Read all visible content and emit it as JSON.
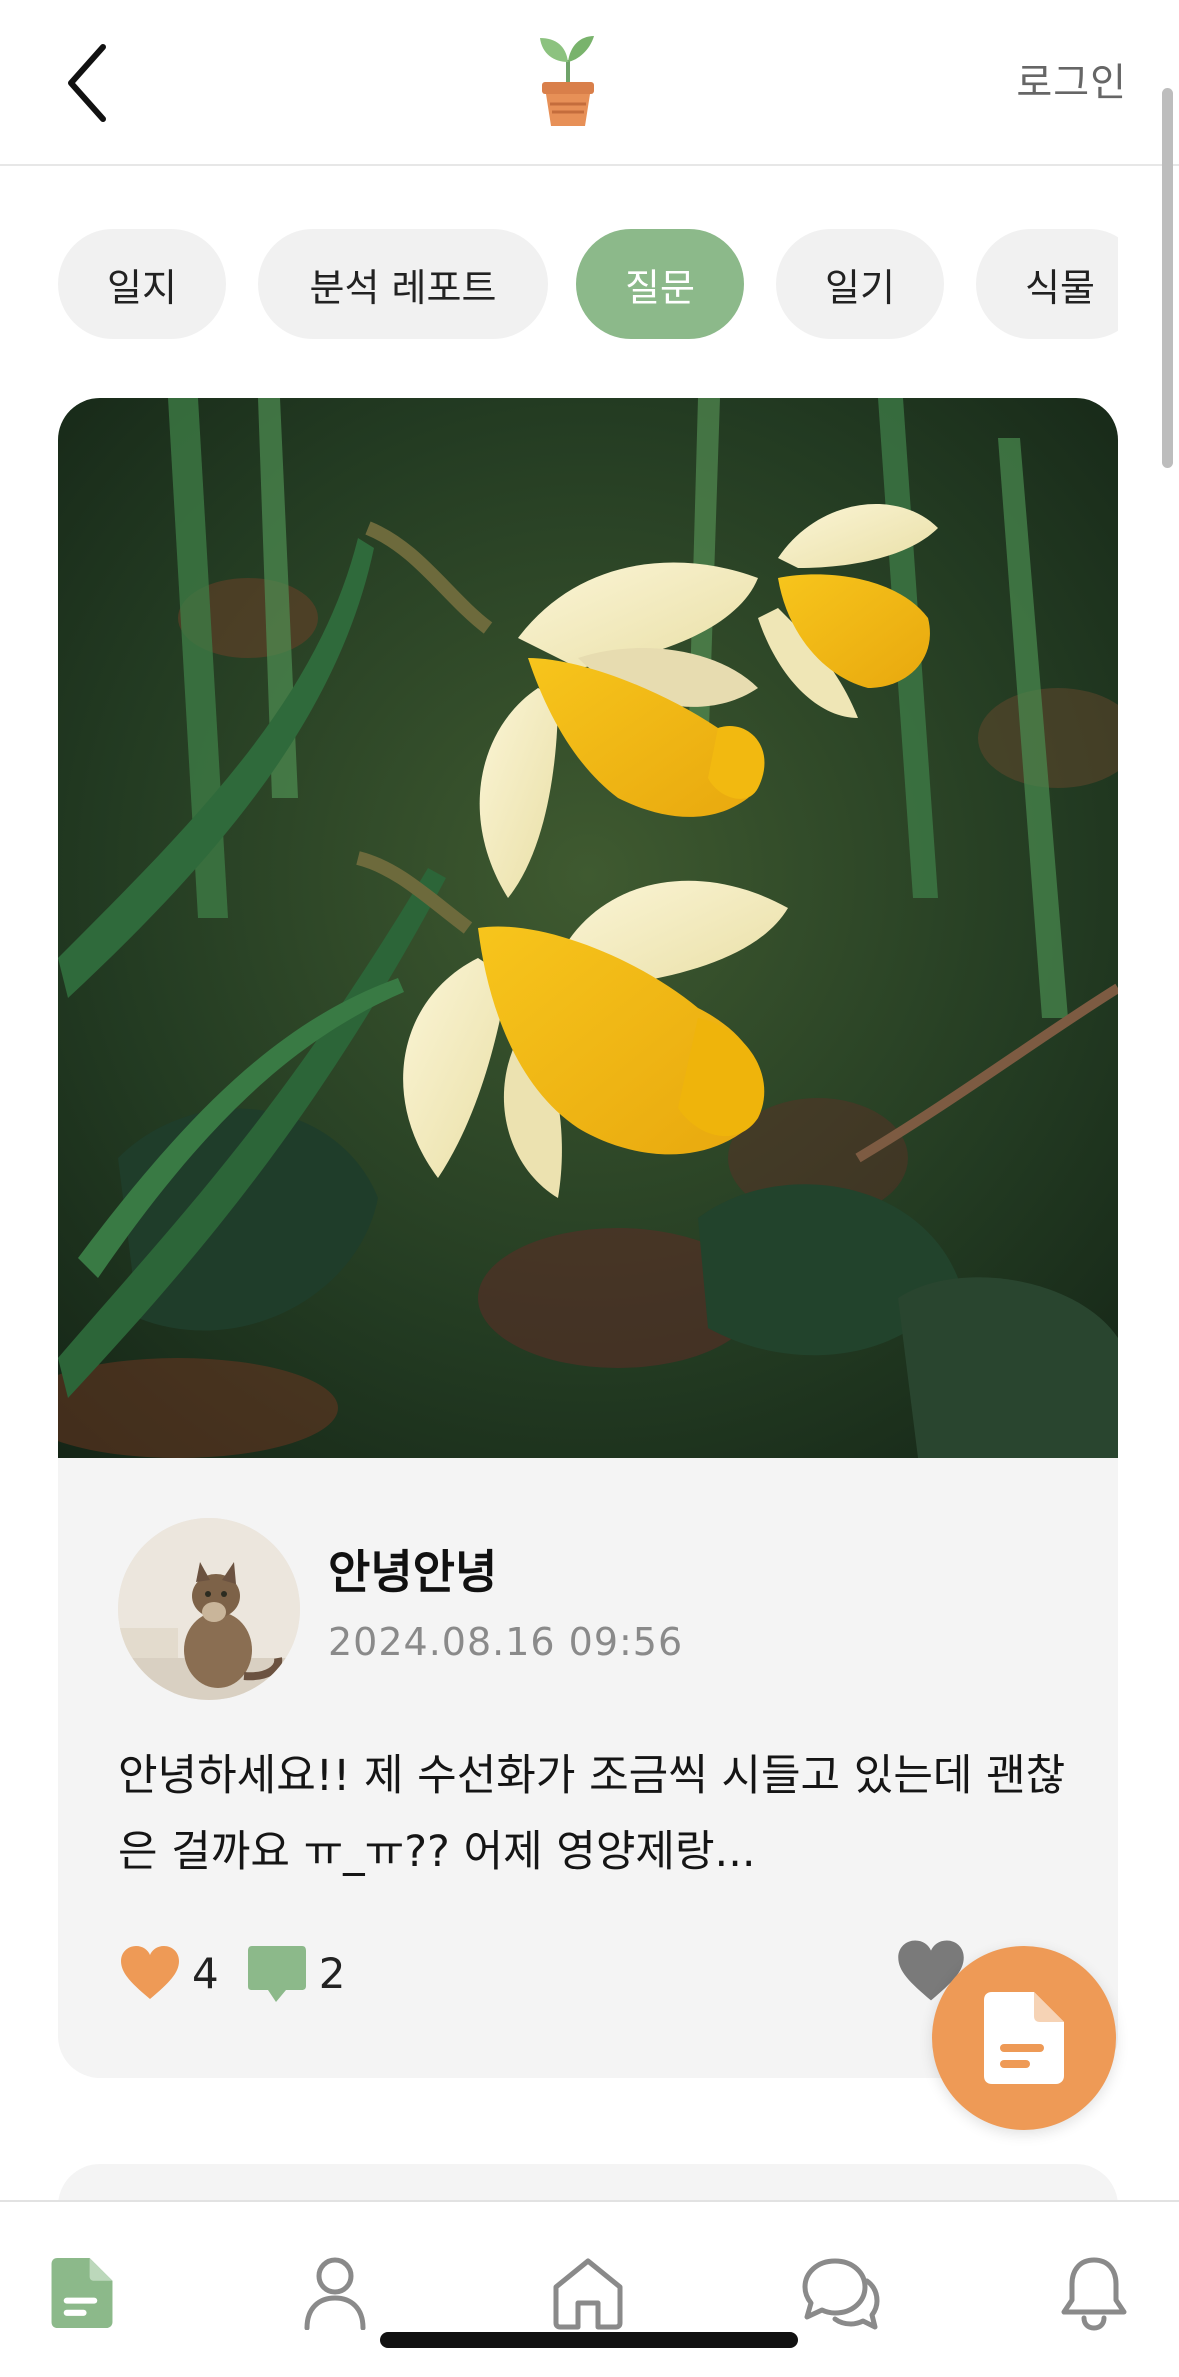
{
  "header": {
    "login_label": "로그인",
    "back_icon": "chevron-left-icon",
    "logo_icon": "plant-pot-logo"
  },
  "tabs": [
    {
      "label": "일지",
      "active": false
    },
    {
      "label": "분석 레포트",
      "active": false
    },
    {
      "label": "질문",
      "active": true
    },
    {
      "label": "일기",
      "active": false
    },
    {
      "label": "식물",
      "active": false
    }
  ],
  "post": {
    "image": "daffodil-photo",
    "author": "안녕안녕",
    "date": "2024.08.16 09:56",
    "body": "안녕하세요!! 제 수선화가 조금씩 시들고 있는데 괜찮은 걸까요 ㅠ_ㅠ?? 어제 영양제랑...",
    "like_count": "4",
    "comment_count": "2"
  },
  "fab": {
    "icon": "document-icon"
  },
  "bottom_nav": [
    {
      "name": "nav-journal",
      "icon": "document-icon",
      "active": true
    },
    {
      "name": "nav-profile",
      "icon": "person-icon",
      "active": false
    },
    {
      "name": "nav-home",
      "icon": "home-icon",
      "active": false
    },
    {
      "name": "nav-chat",
      "icon": "chat-icon",
      "active": false
    },
    {
      "name": "nav-notifications",
      "icon": "bell-icon",
      "active": false
    }
  ],
  "colors": {
    "accent_green": "#8cb98a",
    "accent_orange": "#ee9a56",
    "card_bg": "#f4f4f4",
    "comment_green": "#8cb98a",
    "heart_orange": "#ee9a56"
  }
}
